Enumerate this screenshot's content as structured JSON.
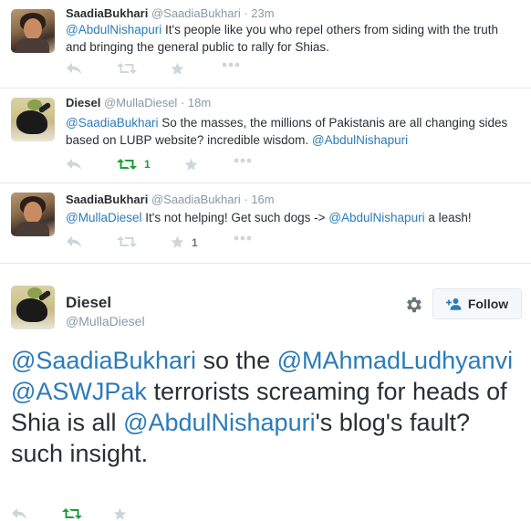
{
  "tweets": [
    {
      "name": "SaadiaBukhari",
      "handle": "@SaadiaBukhari",
      "time": "· 23m",
      "parts": [
        {
          "t": "@AbdulNishapuri",
          "m": true
        },
        {
          "t": " It's people like you who repel others from siding with the truth and bringing the general public to rally for Shias.",
          "m": false
        }
      ],
      "retweet_count": "",
      "favorite_count": ""
    },
    {
      "name": "Diesel",
      "handle": "@MullaDiesel",
      "time": "· 18m",
      "parts": [
        {
          "t": "@SaadiaBukhari",
          "m": true
        },
        {
          "t": " So the masses, the millions of Pakistanis are all changing sides based on LUBP website? incredible wisdom. ",
          "m": false
        },
        {
          "t": "@AbdulNishapuri",
          "m": true
        }
      ],
      "retweet_count": "1",
      "favorite_count": ""
    },
    {
      "name": "SaadiaBukhari",
      "handle": "@SaadiaBukhari",
      "time": "· 16m",
      "parts": [
        {
          "t": "@MullaDiesel",
          "m": true
        },
        {
          "t": " It's not helping! Get such dogs -> ",
          "m": false
        },
        {
          "t": "@AbdulNishapuri",
          "m": true
        },
        {
          "t": " a leash!",
          "m": false
        }
      ],
      "retweet_count": "",
      "favorite_count": "1"
    }
  ],
  "main_tweet": {
    "name": "Diesel",
    "handle": "@MullaDiesel",
    "follow_label": "Follow",
    "parts": [
      {
        "t": "@SaadiaBukhari",
        "m": true
      },
      {
        "t": " so the ",
        "m": false
      },
      {
        "t": "@MAhmadLudhyanvi",
        "m": true
      },
      {
        "t": " ",
        "m": false
      },
      {
        "t": "@ASWJPak",
        "m": true
      },
      {
        "t": " terrorists screaming for heads of Shia is all ",
        "m": false
      },
      {
        "t": "@AbdulNishapuri",
        "m": true
      },
      {
        "t": "'s blog's fault? such insight.",
        "m": false
      }
    ]
  },
  "icons": {
    "reply": "reply-icon",
    "retweet": "retweet-icon",
    "favorite": "star-icon",
    "more": "more-icon",
    "settings": "gear-icon",
    "follow": "add-user-icon"
  },
  "colors": {
    "link": "#2b7bb9",
    "retweeted": "#19a03a",
    "muted": "#8899a6",
    "icon": "#ccd6dd"
  }
}
